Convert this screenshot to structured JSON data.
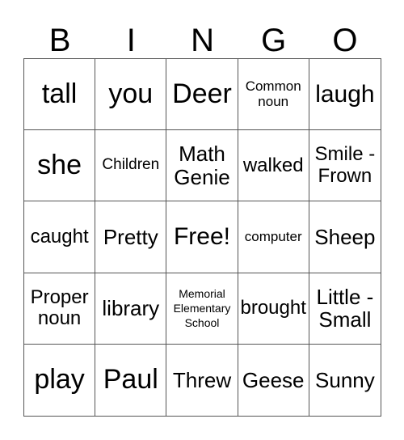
{
  "header": [
    "B",
    "I",
    "N",
    "G",
    "O"
  ],
  "cells": [
    {
      "text": "tall",
      "size": "s36"
    },
    {
      "text": "you",
      "size": "s36"
    },
    {
      "text": "Deer",
      "size": "s36"
    },
    {
      "text": "Common noun",
      "size": "s17"
    },
    {
      "text": "laugh",
      "size": "s32"
    },
    {
      "text": "she",
      "size": "s36"
    },
    {
      "text": "Children",
      "size": "s20"
    },
    {
      "text": "Math Genie",
      "size": "s28"
    },
    {
      "text": "walked",
      "size": "s24"
    },
    {
      "text": "Smile - Frown",
      "size": "s24"
    },
    {
      "text": "caught",
      "size": "s24"
    },
    {
      "text": "Pretty",
      "size": "s28"
    },
    {
      "text": "Free!",
      "size": "s32"
    },
    {
      "text": "computer",
      "size": "s17"
    },
    {
      "text": "Sheep",
      "size": "s28"
    },
    {
      "text": "Proper noun",
      "size": "s24"
    },
    {
      "text": "library",
      "size": "s28"
    },
    {
      "text": "Memorial Elementary School",
      "size": "s14"
    },
    {
      "text": "brought",
      "size": "s24"
    },
    {
      "text": "Little - Small",
      "size": "s28"
    },
    {
      "text": "play",
      "size": "s36"
    },
    {
      "text": "Paul",
      "size": "s36"
    },
    {
      "text": "Threw",
      "size": "s28"
    },
    {
      "text": "Geese",
      "size": "s28"
    },
    {
      "text": "Sunny",
      "size": "s28"
    }
  ]
}
